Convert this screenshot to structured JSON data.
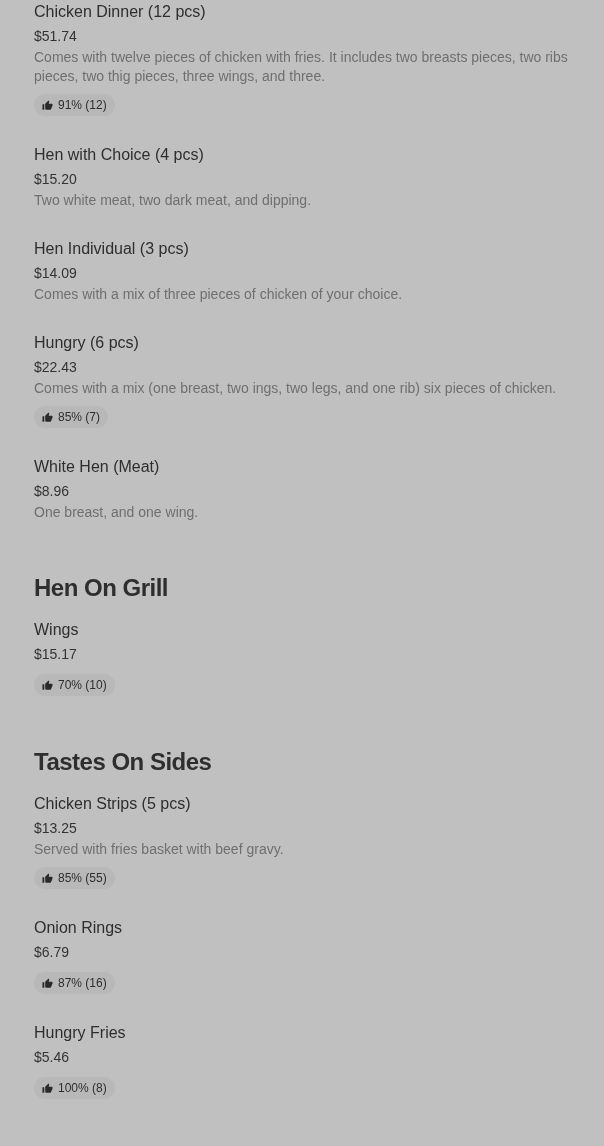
{
  "sections": [
    {
      "items": [
        {
          "name": "Chicken Dinner (12 pcs)",
          "price": "$51.74",
          "description": "Comes with twelve pieces of chicken with fries. It includes two breasts pieces, two ribs pieces, two thig pieces, three wings, and three.",
          "rating": "91% (12)"
        },
        {
          "name": "Hen with Choice (4 pcs)",
          "price": "$15.20",
          "description": "Two white meat, two dark meat, and dipping."
        },
        {
          "name": "Hen Individual (3 pcs)",
          "price": "$14.09",
          "description": "Comes with a mix of three pieces of chicken of your choice."
        },
        {
          "name": "Hungry (6 pcs)",
          "price": "$22.43",
          "description": "Comes with a mix (one breast, two ings, two legs, and one rib) six pieces of chicken.",
          "rating": "85% (7)"
        },
        {
          "name": "White Hen (Meat)",
          "price": "$8.96",
          "description": "One breast, and one wing."
        }
      ]
    },
    {
      "title": "Hen On Grill",
      "items": [
        {
          "name": "Wings",
          "price": "$15.17",
          "rating": "70% (10)"
        }
      ]
    },
    {
      "title": "Tastes On Sides",
      "items": [
        {
          "name": "Chicken Strips (5 pcs)",
          "price": "$13.25",
          "description": "Served with fries basket with beef gravy.",
          "rating": "85% (55)"
        },
        {
          "name": "Onion Rings",
          "price": "$6.79",
          "rating": "87% (16)"
        },
        {
          "name": "Hungry Fries",
          "price": "$5.46",
          "rating": "100% (8)"
        }
      ]
    }
  ]
}
